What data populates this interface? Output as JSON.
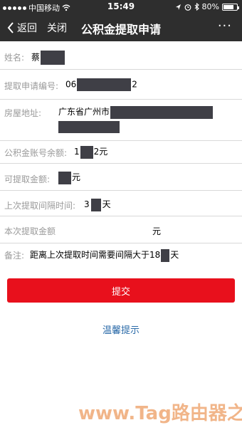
{
  "status_bar": {
    "carrier": "中国移动",
    "time": "15:49",
    "battery": "80%",
    "battery_level": 0.8
  },
  "nav": {
    "back": "返回",
    "close": "关闭",
    "title": "公积金提取申请",
    "more": "···"
  },
  "form": {
    "name_label": "姓名:",
    "name_value": "蔡",
    "app_no_label": "提取申请编号:",
    "app_no_prefix": "06",
    "app_no_suffix": "2",
    "address_label": "房屋地址:",
    "address_value": "广东省广州市",
    "balance_label": "公积金账号余额:",
    "balance_prefix": "1",
    "balance_suffix": "2元",
    "available_label": "可提取金额:",
    "available_suffix": "元",
    "interval_label": "上次提取间隔时间:",
    "interval_prefix": "3",
    "interval_suffix": "天",
    "current_label": "本次提取金额",
    "current_unit": "元",
    "remark_label": "备注:",
    "remark_value": "距离上次提取时间需要间隔大于18",
    "remark_suffix": "天"
  },
  "actions": {
    "submit": "提交",
    "tip": "温馨提示"
  },
  "watermark": "www.Tag路由器之家"
}
